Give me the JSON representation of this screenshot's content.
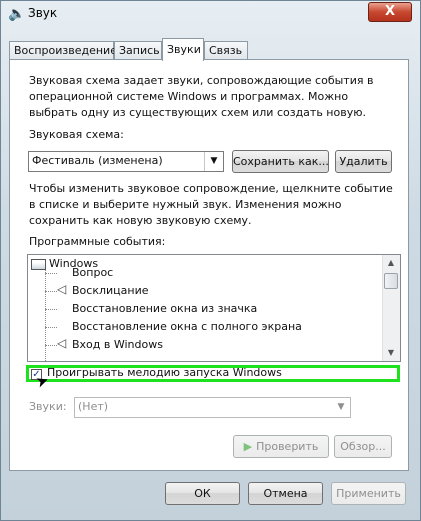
{
  "window": {
    "title": "Звук",
    "close_label": "X"
  },
  "tabs": [
    {
      "label": "Воспроизведение",
      "active": false
    },
    {
      "label": "Запись",
      "active": false
    },
    {
      "label": "Звуки",
      "active": true
    },
    {
      "label": "Связь",
      "active": false
    }
  ],
  "sounds": {
    "description": "Звуковая схема задает звуки, сопровождающие события в операционной системе Windows и программах. Можно выбрать одну из существующих схем или создать новую.",
    "scheme_label": "Звуковая схема:",
    "scheme_value": "Фестиваль (изменена)",
    "save_as_label": "Сохранить как...",
    "delete_label": "Удалить",
    "instructions": "Чтобы изменить звуковое сопровождение, щелкните событие в списке и выберите нужный звук. Изменения можно сохранить как новую звуковую схему.",
    "events_label": "Программные события:",
    "events": [
      {
        "label": "Windows",
        "level": 0,
        "has_sound": false
      },
      {
        "label": "Вопрос",
        "level": 1,
        "has_sound": false
      },
      {
        "label": "Восклицание",
        "level": 1,
        "has_sound": true
      },
      {
        "label": "Восстановление окна из значка",
        "level": 1,
        "has_sound": false
      },
      {
        "label": "Восстановление окна с полного экрана",
        "level": 1,
        "has_sound": false
      },
      {
        "label": "Вход в Windows",
        "level": 1,
        "has_sound": true
      }
    ],
    "startup_checkbox_label": "Проигрывать мелодию запуска Windows",
    "startup_checked": true,
    "sounds_label": "Звуки:",
    "sounds_value": "(Нет)",
    "test_label": "Проверить",
    "browse_label": "Обзор..."
  },
  "footer": {
    "ok_label": "ОК",
    "cancel_label": "Отмена",
    "apply_label": "Применить"
  },
  "colors": {
    "highlight_border": "#1de21d"
  }
}
